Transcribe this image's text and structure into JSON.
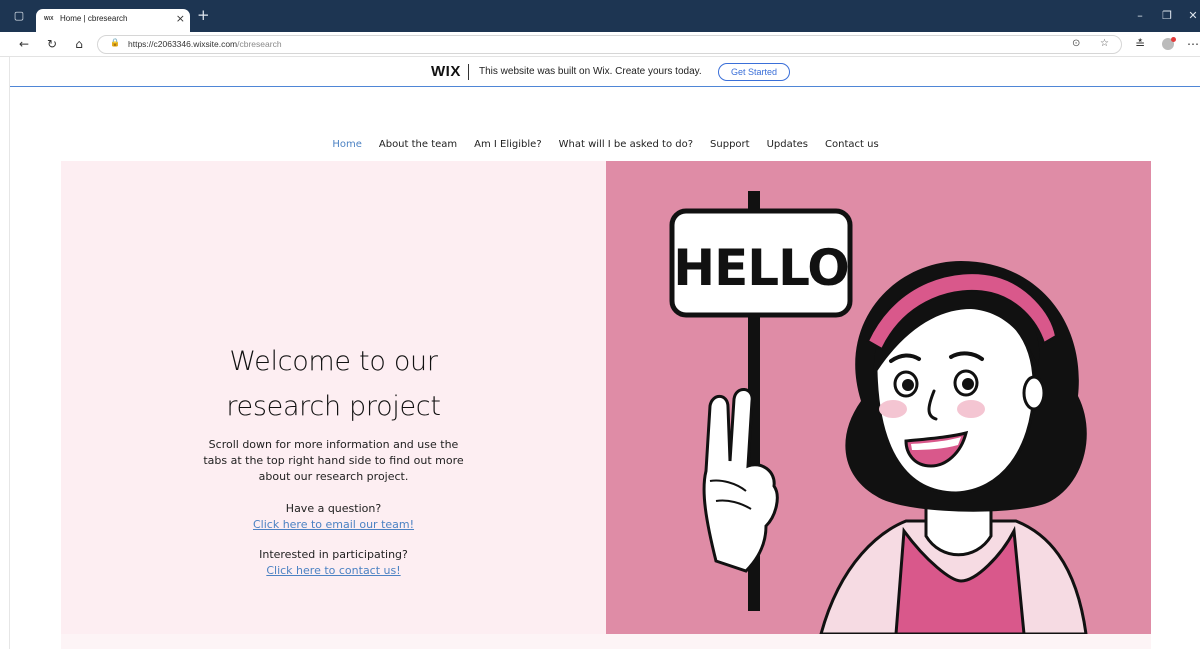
{
  "browser": {
    "tab_title": "Home | cbresearch",
    "tab_favicon": "WiX",
    "url_host": "https://c2063346.wixsite.com",
    "url_path": "/cbresearch"
  },
  "wix_banner": {
    "logo": "WIX",
    "message": "This website was built on Wix. Create yours today.",
    "cta": "Get Started"
  },
  "nav": {
    "items": [
      {
        "label": "Home",
        "active": true
      },
      {
        "label": "About the team"
      },
      {
        "label": "Am I Eligible?"
      },
      {
        "label": "What will I be asked to do?"
      },
      {
        "label": "Support"
      },
      {
        "label": "Updates"
      },
      {
        "label": "Contact us"
      }
    ]
  },
  "hero": {
    "title_line1": "Welcome to our",
    "title_line2": "research project",
    "intro": "Scroll down for more information and use the tabs at the top right hand side to find out more about our research project.",
    "question_label": "Have a question?",
    "question_link": "Click here to email our team!",
    "participate_label": "Interested in participating?",
    "participate_link": "Click here to contact us!",
    "sign_text": "HELLO"
  },
  "colors": {
    "titlebar": "#1d3552",
    "accent_link": "#4c82c3",
    "hero_left_bg": "#fdeef2",
    "hero_right_bg": "#df8ca6",
    "headband": "#d9588b"
  }
}
